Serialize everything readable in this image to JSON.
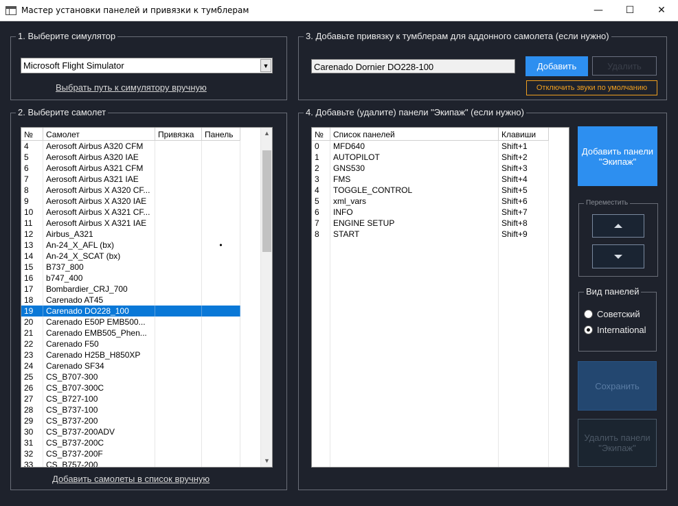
{
  "window": {
    "title": "Мастер установки панелей и привязки к тумблерам",
    "minimize": "—",
    "maximize": "☐",
    "close": "✕"
  },
  "section1": {
    "legend": "1. Выберите симулятор",
    "simulator_value": "Microsoft Flight Simulator",
    "combo_arrow": "▼",
    "manual_path_link": "Выбрать путь к симулятору вручную"
  },
  "section2": {
    "legend": "2. Выберите самолет",
    "columns": [
      "№",
      "Самолет",
      "Привязка",
      "Панель"
    ],
    "rows": [
      {
        "n": "4",
        "name": "Aerosoft Airbus A320 CFM",
        "bind": "",
        "panel": ""
      },
      {
        "n": "5",
        "name": "Aerosoft Airbus A320 IAE",
        "bind": "",
        "panel": ""
      },
      {
        "n": "6",
        "name": "Aerosoft Airbus A321 CFM",
        "bind": "",
        "panel": ""
      },
      {
        "n": "7",
        "name": "Aerosoft Airbus A321 IAE",
        "bind": "",
        "panel": ""
      },
      {
        "n": "8",
        "name": "Aerosoft Airbus X A320 CF...",
        "bind": "",
        "panel": ""
      },
      {
        "n": "9",
        "name": "Aerosoft Airbus X A320 IAE",
        "bind": "",
        "panel": ""
      },
      {
        "n": "10",
        "name": "Aerosoft Airbus X A321 CF...",
        "bind": "",
        "panel": ""
      },
      {
        "n": "11",
        "name": "Aerosoft Airbus X A321 IAE",
        "bind": "",
        "panel": ""
      },
      {
        "n": "12",
        "name": "Airbus_A321",
        "bind": "",
        "panel": ""
      },
      {
        "n": "13",
        "name": "An-24_X_AFL (bx)",
        "bind": "",
        "panel": "•"
      },
      {
        "n": "14",
        "name": "An-24_X_SCAT (bx)",
        "bind": "",
        "panel": ""
      },
      {
        "n": "15",
        "name": "B737_800",
        "bind": "",
        "panel": ""
      },
      {
        "n": "16",
        "name": "b747_400",
        "bind": "",
        "panel": ""
      },
      {
        "n": "17",
        "name": "Bombardier_CRJ_700",
        "bind": "",
        "panel": ""
      },
      {
        "n": "18",
        "name": "Carenado AT45",
        "bind": "",
        "panel": ""
      },
      {
        "n": "19",
        "name": "Carenado DO228_100",
        "bind": "",
        "panel": ""
      },
      {
        "n": "20",
        "name": "Carenado E50P EMB500...",
        "bind": "",
        "panel": ""
      },
      {
        "n": "21",
        "name": "Carenado EMB505_Phen...",
        "bind": "",
        "panel": ""
      },
      {
        "n": "22",
        "name": "Carenado F50",
        "bind": "",
        "panel": ""
      },
      {
        "n": "23",
        "name": "Carenado H25B_H850XP",
        "bind": "",
        "panel": ""
      },
      {
        "n": "24",
        "name": "Carenado SF34",
        "bind": "",
        "panel": ""
      },
      {
        "n": "25",
        "name": "CS_B707-300",
        "bind": "",
        "panel": ""
      },
      {
        "n": "26",
        "name": "CS_B707-300C",
        "bind": "",
        "panel": ""
      },
      {
        "n": "27",
        "name": "CS_B727-100",
        "bind": "",
        "panel": ""
      },
      {
        "n": "28",
        "name": "CS_B737-100",
        "bind": "",
        "panel": ""
      },
      {
        "n": "29",
        "name": "CS_B737-200",
        "bind": "",
        "panel": ""
      },
      {
        "n": "30",
        "name": "CS_B737-200ADV",
        "bind": "",
        "panel": ""
      },
      {
        "n": "31",
        "name": "CS_B737-200C",
        "bind": "",
        "panel": ""
      },
      {
        "n": "32",
        "name": "CS_B737-200F",
        "bind": "",
        "panel": ""
      },
      {
        "n": "33",
        "name": "CS_B757-200",
        "bind": "",
        "panel": ""
      }
    ],
    "selected_row": "19",
    "scroll_up": "▲",
    "scroll_down": "▼",
    "add_manual_link": "Добавить самолеты в список вручную"
  },
  "section3": {
    "legend": "3. Добавьте привязку к тумблерам для аддонного самолета (если нужно)",
    "addon_value": "Carenado Dornier DO228-100",
    "add_button": "Добавить",
    "delete_button": "Удалить",
    "disable_sounds_button": "Отключить звуки по умолчанию"
  },
  "section4": {
    "legend": "4. Добавьте (удалите) панели \"Экипаж\" (если нужно)",
    "columns": [
      "№",
      "Список панелей",
      "Клавиши"
    ],
    "rows": [
      {
        "n": "0",
        "name": "MFD640",
        "key": "Shift+1"
      },
      {
        "n": "1",
        "name": "AUTOPILOT",
        "key": "Shift+2"
      },
      {
        "n": "2",
        "name": "GNS530",
        "key": "Shift+3"
      },
      {
        "n": "3",
        "name": "FMS",
        "key": "Shift+4"
      },
      {
        "n": "4",
        "name": "TOGGLE_CONTROL",
        "key": "Shift+5"
      },
      {
        "n": "5",
        "name": "xml_vars",
        "key": "Shift+6"
      },
      {
        "n": "6",
        "name": "INFO",
        "key": "Shift+7"
      },
      {
        "n": "7",
        "name": "ENGINE SETUP",
        "key": "Shift+8"
      },
      {
        "n": "8",
        "name": "START",
        "key": "Shift+9"
      }
    ],
    "add_crew_button": "Добавить панели \"Экипаж\"",
    "move_legend": "Переместить",
    "view_legend": "Вид панелей",
    "view_options": [
      "Советский",
      "International"
    ],
    "view_selected": "International",
    "save_button": "Сохранить",
    "delete_crew_button": "Удалить панели \"Экипаж\""
  }
}
